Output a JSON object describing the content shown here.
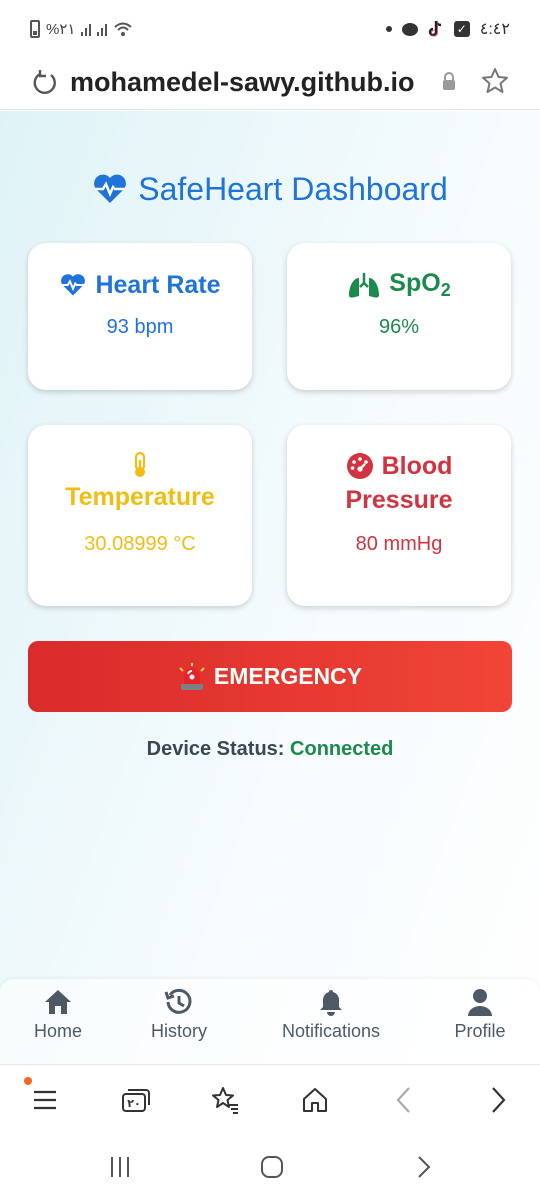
{
  "status_bar": {
    "battery": "%٢١",
    "clock": "٤:٤٢"
  },
  "url_bar": {
    "url": "mohamedel-sawy.github.io"
  },
  "dashboard": {
    "title": "SafeHeart Dashboard",
    "cards": {
      "heart_rate": {
        "label": "Heart Rate",
        "value": "93 bpm"
      },
      "spo2": {
        "label": "SpO",
        "label_sub": "2",
        "value": "96%"
      },
      "temperature": {
        "label": "Temperature",
        "value": "30.08999 °C"
      },
      "blood_pressure": {
        "label_line1": "Blood",
        "label_line2": "Pressure",
        "value": "80 mmHg"
      }
    },
    "emergency_label": "EMERGENCY",
    "device_status": {
      "label": "Device Status:",
      "value": "Connected"
    }
  },
  "app_nav": [
    {
      "label": "Home",
      "icon": "home-icon"
    },
    {
      "label": "History",
      "icon": "history-icon"
    },
    {
      "label": "Notifications",
      "icon": "bell-icon"
    },
    {
      "label": "Profile",
      "icon": "user-icon"
    }
  ],
  "browser_toolbar": {
    "tabs_count": "٢٠"
  },
  "colors": {
    "blue": "#1f73d9",
    "green": "#1c8a4c",
    "yellow": "#f2bd13",
    "red": "#d23340",
    "emergency_start": "#d92b2b",
    "emergency_end": "#f04537"
  }
}
